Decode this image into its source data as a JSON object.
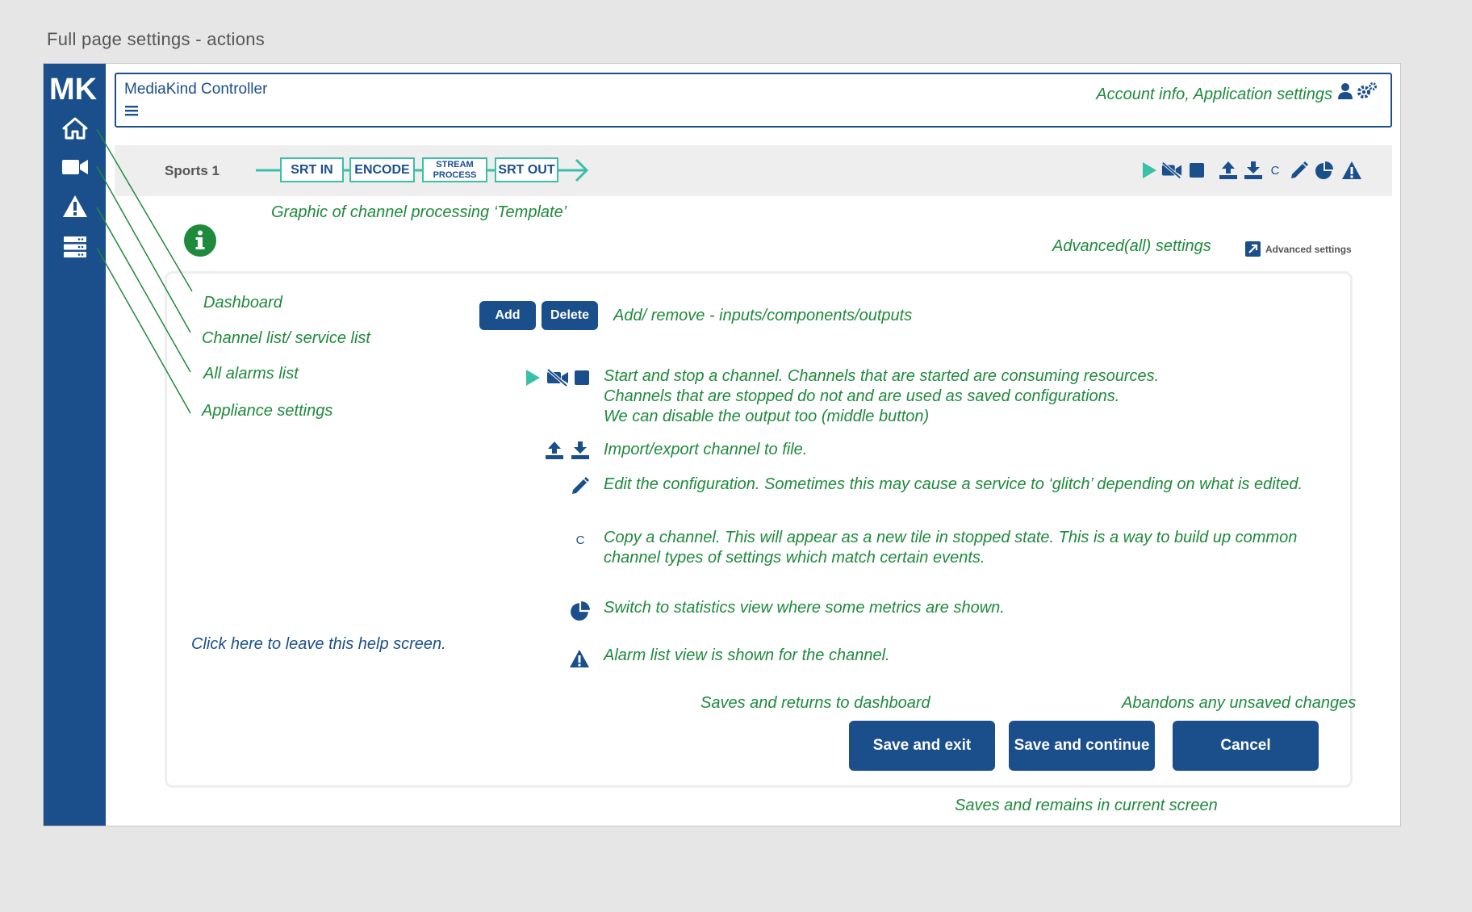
{
  "page_title": "Full page settings - actions",
  "app": {
    "title": "MediaKind Controller",
    "logo_text": "MK"
  },
  "header": {
    "account_note": "Account info, Application settings"
  },
  "channel": {
    "name": "Sports 1",
    "pipeline": [
      "SRT IN",
      "ENCODE",
      "STREAM PROCESS",
      "SRT OUT"
    ],
    "pipeline_process_lines": [
      "STREAM",
      "PROCESS"
    ],
    "copy_glyph": "C"
  },
  "annotations": {
    "template_graphic": "Graphic of channel processing ‘Template’",
    "advanced_note": "Advanced(all) settings",
    "advanced_link": "Advanced settings",
    "dashboard": "Dashboard",
    "channel_list": "Channel list/ service list",
    "alarms_list": "All alarms list",
    "appliance_settings": "Appliance settings",
    "leave_help": "Click here to leave this help screen.",
    "add_remove": "Add/ remove - inputs/components/outputs",
    "start_stop_lines": [
      "Start and stop a channel. Channels that are started are consuming resources.",
      "Channels that are stopped do not and are used as saved configurations.",
      "We can disable the output too (middle button)"
    ],
    "import_export": "Import/export channel to file.",
    "edit": "Edit the configuration. Sometimes this may cause a service to ‘glitch’ depending on what is edited.",
    "copy_lines": [
      "Copy a channel. This will appear as a new tile in stopped state. This is a way to build up common",
      "channel types of settings which match certain events."
    ],
    "statistics": "Switch to statistics view where some metrics are shown.",
    "alarm_view": "Alarm list view is shown for the channel.",
    "save_exit_note": "Saves and returns to dashboard",
    "cancel_note": "Abandons any unsaved changes",
    "save_continue_note": "Saves and remains in current screen"
  },
  "buttons": {
    "add": "Add",
    "delete": "Delete",
    "save_exit": "Save and exit",
    "save_continue": "Save and continue",
    "cancel": "Cancel"
  },
  "colors": {
    "brand_blue": "#1a4f8b",
    "annotation_green": "#1e8a3c",
    "pipeline_teal": "#3cbfa8",
    "play_green": "#3cbfa8",
    "info_green": "#1e8a3c"
  },
  "icons": {
    "sidebar": [
      "home-icon",
      "video-camera-icon",
      "warning-icon",
      "server-icon"
    ],
    "toolbar": [
      "play-icon",
      "video-off-icon",
      "stop-icon",
      "upload-icon",
      "download-icon",
      "copy-c-icon",
      "pencil-icon",
      "pie-chart-icon",
      "warning-icon"
    ],
    "info": "info-icon",
    "advanced": "external-link-icon",
    "account": "user-icon",
    "settings": "gears-icon"
  }
}
